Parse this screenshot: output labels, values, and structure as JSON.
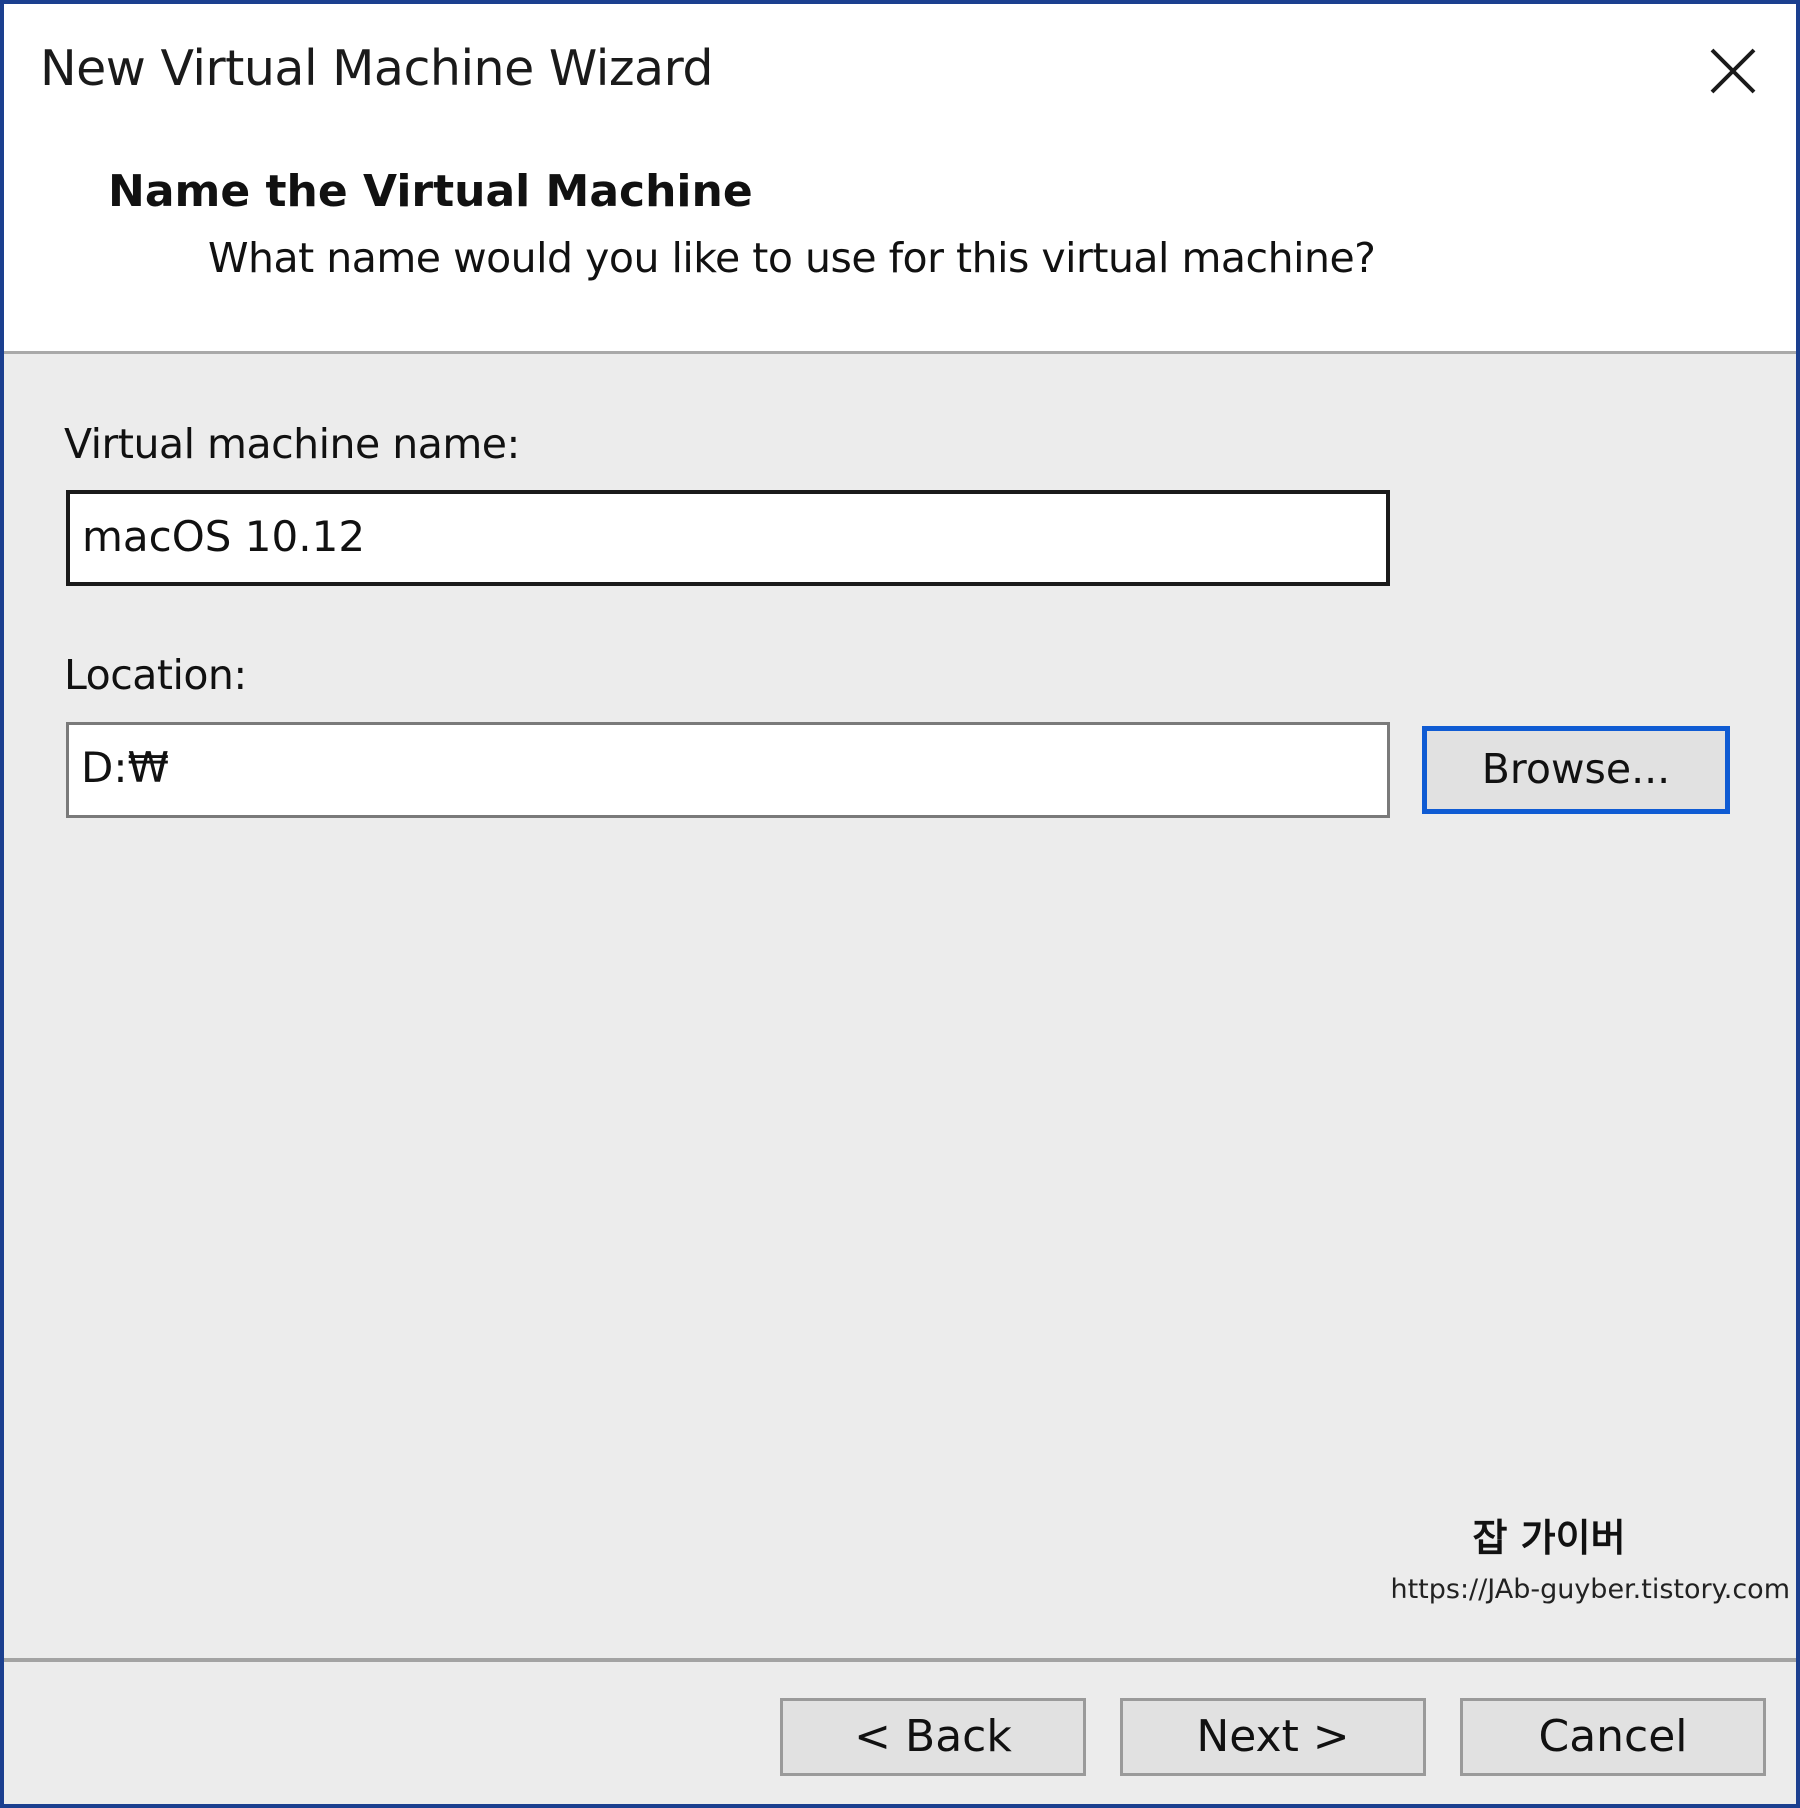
{
  "window": {
    "title": "New Virtual Machine Wizard",
    "close_icon": "close-icon"
  },
  "step": {
    "title": "Name the Virtual Machine",
    "subtitle": "What name would you like to use for this virtual machine?"
  },
  "form": {
    "vm_name_label": "Virtual machine name:",
    "vm_name_value": "macOS 10.12",
    "location_label": "Location:",
    "location_value": "D:₩",
    "browse_label": "Browse..."
  },
  "watermark": {
    "name": "잡 가이버",
    "url": "https://JAb-guyber.tistory.com"
  },
  "footer": {
    "back_label": "< Back",
    "next_label": "Next >",
    "cancel_label": "Cancel"
  },
  "colors": {
    "focus_border": "#0f5bd3",
    "window_border": "#1b3f8f",
    "dialog_background": "#ececec",
    "header_background": "#ffffff",
    "button_face": "#e1e1e1"
  }
}
